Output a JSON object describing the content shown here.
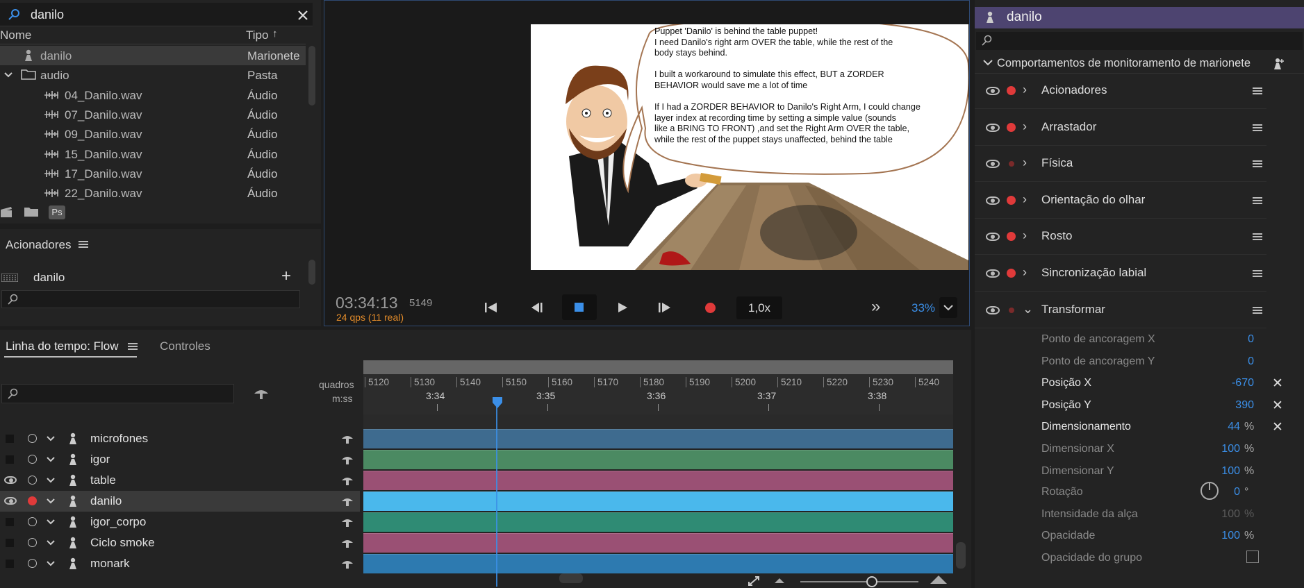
{
  "project": {
    "search_value": "danilo",
    "col_name": "Nome",
    "col_type": "Tipo",
    "rows": [
      {
        "name": "danilo",
        "type": "Marionete"
      },
      {
        "name": "audio",
        "type": "Pasta"
      },
      {
        "name": "04_Danilo.wav",
        "type": "Áudio"
      },
      {
        "name": "07_Danilo.wav",
        "type": "Áudio"
      },
      {
        "name": "09_Danilo.wav",
        "type": "Áudio"
      },
      {
        "name": "15_Danilo.wav",
        "type": "Áudio"
      },
      {
        "name": "17_Danilo.wav",
        "type": "Áudio"
      },
      {
        "name": "22_Danilo.wav",
        "type": "Áudio"
      }
    ],
    "ps_badge": "Ps"
  },
  "triggers": {
    "title": "Acionadores",
    "item": "danilo"
  },
  "preview": {
    "note_lines": [
      "Puppet 'Danilo' is behind the table puppet!",
      "I need Danilo's right arm OVER the table, while the rest of the",
      "body stays behind.",
      "",
      "I built a workaround to simulate this effect, BUT a ZORDER",
      "BEHAVIOR would save me a lot of time",
      "",
      "If I had a ZORDER BEHAVIOR to Danilo's Right Arm, I could change",
      "layer index at recording time by setting a simple value (sounds",
      "like a BRING TO FRONT) ,and set the Right Arm OVER the table,",
      "while the rest of the puppet stays unaffected, behind the table"
    ],
    "timecode": "03:34:13",
    "frame": "5149",
    "fps": "24 qps (11 real)",
    "speed": "1,0x",
    "zoom": "33%"
  },
  "properties": {
    "puppet_name": "danilo",
    "group_title": "Comportamentos de monitoramento de marionete",
    "behaviors": [
      "Acionadores",
      "Arrastador",
      "Física",
      "Orientação do olhar",
      "Rosto",
      "Sincronização labial",
      "Transformar"
    ],
    "transform_params": [
      {
        "label": "Ponto de ancoragem X",
        "value": "0",
        "unit": ""
      },
      {
        "label": "Ponto de ancoragem Y",
        "value": "0",
        "unit": ""
      },
      {
        "label": "Posição X",
        "value": "-670",
        "unit": ""
      },
      {
        "label": "Posição Y",
        "value": "390",
        "unit": ""
      },
      {
        "label": "Dimensionamento",
        "value": "44",
        "unit": "%"
      },
      {
        "label": "Dimensionar X",
        "value": "100",
        "unit": "%"
      },
      {
        "label": "Dimensionar Y",
        "value": "100",
        "unit": "%"
      },
      {
        "label": "Rotação",
        "value": "0",
        "unit": "°"
      },
      {
        "label": "Intensidade da alça",
        "value": "100",
        "unit": "%"
      },
      {
        "label": "Opacidade",
        "value": "100",
        "unit": "%"
      },
      {
        "label": "Opacidade do grupo",
        "value": "",
        "unit": ""
      }
    ]
  },
  "timeline": {
    "tab_label": "Linha do tempo: Flow",
    "tab_controls": "Controles",
    "label_frames": "quadros",
    "label_mss": "m:ss",
    "frame_ticks": [
      "5120",
      "5130",
      "5140",
      "5150",
      "5160",
      "5170",
      "5180",
      "5190",
      "5200",
      "5210",
      "5220",
      "5230",
      "5240"
    ],
    "time_ticks": [
      "3:34",
      "3:35",
      "3:36",
      "3:37",
      "3:38"
    ],
    "layers": [
      "microfones",
      "igor",
      "table",
      "danilo",
      "igor_corpo",
      "Ciclo smoke",
      "monark"
    ],
    "track_colors": [
      "#3e6b8f",
      "#4b8a62",
      "#9a5074",
      "#4ab8ec",
      "#2f8b74",
      "#9a5074",
      "#2d7ab0"
    ]
  }
}
